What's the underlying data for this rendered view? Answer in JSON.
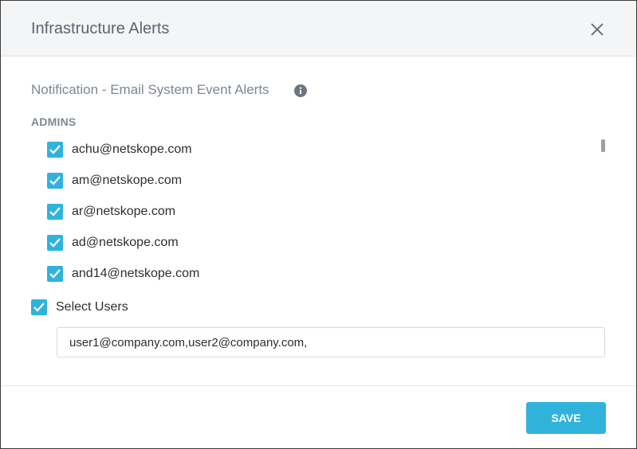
{
  "modal": {
    "title": "Infrastructure Alerts",
    "close_icon": "close-icon"
  },
  "notification": {
    "title": "Notification - Email System Event Alerts",
    "info_icon": "info-icon"
  },
  "admins": {
    "label": "ADMINS",
    "items": [
      {
        "email": "achu@netskope.com",
        "checked": true
      },
      {
        "email": "am@netskope.com",
        "checked": true
      },
      {
        "email": "ar@netskope.com",
        "checked": true
      },
      {
        "email": "ad@netskope.com",
        "checked": true
      },
      {
        "email": "and14@netskope.com",
        "checked": true
      }
    ]
  },
  "select_users": {
    "label": "Select Users",
    "checked": true,
    "input_value": "user1@company.com,user2@company.com,"
  },
  "footer": {
    "save_label": "SAVE"
  },
  "colors": {
    "accent": "#2fb3dd",
    "header_bg": "#f4f5f6"
  }
}
